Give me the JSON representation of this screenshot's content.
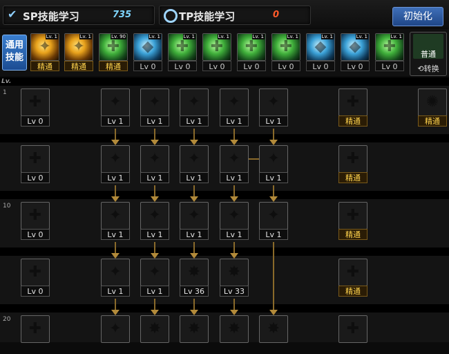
{
  "header": {
    "sp": {
      "label": "SP技能学习",
      "value": "735"
    },
    "tp": {
      "label": "TP技能学习",
      "value": "0"
    },
    "reset_label": "初始化"
  },
  "general": {
    "label_line1": "通用",
    "label_line2": "技能",
    "skills": [
      {
        "name": "general-skill-1",
        "icon": "gold",
        "level": "精通",
        "master": true,
        "tag": "Lv. 1"
      },
      {
        "name": "general-skill-2",
        "icon": "gold",
        "level": "精通",
        "master": true,
        "tag": "Lv. 1"
      },
      {
        "name": "general-skill-3",
        "icon": "green",
        "level": "精通",
        "master": true,
        "tag": "Lv. 90"
      },
      {
        "name": "general-skill-4",
        "icon": "blue",
        "level": "Lv 0",
        "master": false,
        "tag": "Lv. 1"
      },
      {
        "name": "general-skill-5",
        "icon": "green",
        "level": "Lv 0",
        "master": false,
        "tag": "Lv. 1"
      },
      {
        "name": "general-skill-6",
        "icon": "green",
        "level": "Lv 0",
        "master": false,
        "tag": "Lv. 1"
      },
      {
        "name": "general-skill-7",
        "icon": "green",
        "level": "Lv 0",
        "master": false,
        "tag": "Lv. 1"
      },
      {
        "name": "general-skill-8",
        "icon": "green",
        "level": "Lv 0",
        "master": false,
        "tag": "Lv. 1"
      },
      {
        "name": "general-skill-9",
        "icon": "blue",
        "level": "Lv 0",
        "master": false,
        "tag": "Lv. 1"
      },
      {
        "name": "general-skill-10",
        "icon": "blue",
        "level": "Lv 0",
        "master": false,
        "tag": "Lv. 1"
      },
      {
        "name": "general-skill-11",
        "icon": "green",
        "level": "Lv 0",
        "master": false,
        "tag": "Lv. 1"
      }
    ],
    "switch": {
      "top": "普通",
      "bottom": "⟲转换"
    }
  },
  "tree": {
    "lv_header": "Lv.",
    "row_levels": [
      "1",
      "10",
      "20"
    ],
    "skills": [
      {
        "name": "skill-r1-c1",
        "icon": "green",
        "level": "Lv 0",
        "master": false
      },
      {
        "name": "skill-r1-c2",
        "icon": "gold",
        "level": "Lv 1",
        "master": false
      },
      {
        "name": "skill-r1-c3",
        "icon": "gold",
        "level": "Lv 1",
        "master": false
      },
      {
        "name": "skill-r1-c4",
        "icon": "gold",
        "level": "Lv 1",
        "master": false
      },
      {
        "name": "skill-r1-c5",
        "icon": "gold",
        "level": "Lv 1",
        "master": false
      },
      {
        "name": "skill-r1-c6",
        "icon": "gold",
        "level": "Lv 1",
        "master": false
      },
      {
        "name": "skill-r1-c7",
        "icon": "green",
        "level": "精通",
        "master": true
      },
      {
        "name": "skill-r1-c8",
        "icon": "fire",
        "level": "精通",
        "master": true
      },
      {
        "name": "skill-r2-c1",
        "icon": "green",
        "level": "Lv 0",
        "master": false
      },
      {
        "name": "skill-r2-c2",
        "icon": "gold",
        "level": "Lv 1",
        "master": false
      },
      {
        "name": "skill-r2-c3",
        "icon": "gold",
        "level": "Lv 1",
        "master": false
      },
      {
        "name": "skill-r2-c4",
        "icon": "gold",
        "level": "Lv 1",
        "master": false
      },
      {
        "name": "skill-r2-c5",
        "icon": "gold",
        "level": "Lv 1",
        "master": false
      },
      {
        "name": "skill-r2-c6",
        "icon": "gold",
        "level": "Lv 1",
        "master": false
      },
      {
        "name": "skill-r2-c7",
        "icon": "green",
        "level": "精通",
        "master": true
      },
      {
        "name": "skill-r3-c1",
        "icon": "green",
        "level": "Lv 0",
        "master": false
      },
      {
        "name": "skill-r3-c2",
        "icon": "gold",
        "level": "Lv 1",
        "master": false
      },
      {
        "name": "skill-r3-c3",
        "icon": "gold",
        "level": "Lv 1",
        "master": false
      },
      {
        "name": "skill-r3-c4",
        "icon": "gold",
        "level": "Lv 1",
        "master": false
      },
      {
        "name": "skill-r3-c5",
        "icon": "gold",
        "level": "Lv 1",
        "master": false
      },
      {
        "name": "skill-r3-c6",
        "icon": "gold",
        "level": "Lv 1",
        "master": false
      },
      {
        "name": "skill-r3-c7",
        "icon": "green",
        "level": "精通",
        "master": true
      },
      {
        "name": "skill-r4-c1",
        "icon": "green",
        "level": "Lv 0",
        "master": false
      },
      {
        "name": "skill-r4-c2",
        "icon": "gold",
        "level": "Lv 1",
        "master": false
      },
      {
        "name": "skill-r4-c3",
        "icon": "gold",
        "level": "Lv 1",
        "master": false
      },
      {
        "name": "skill-r4-c4",
        "icon": "red",
        "level": "Lv 36",
        "master": false
      },
      {
        "name": "skill-r4-c5",
        "icon": "red",
        "level": "Lv 33",
        "master": false
      },
      {
        "name": "skill-r4-c7",
        "icon": "green",
        "level": "精通",
        "master": true
      },
      {
        "name": "skill-r5-c1",
        "icon": "green",
        "level": "",
        "master": false
      },
      {
        "name": "skill-r5-c2",
        "icon": "gold",
        "level": "",
        "master": false
      },
      {
        "name": "skill-r5-c3",
        "icon": "red",
        "level": "",
        "master": false
      },
      {
        "name": "skill-r5-c4",
        "icon": "red",
        "level": "",
        "master": false
      },
      {
        "name": "skill-r5-c5",
        "icon": "red",
        "level": "",
        "master": false
      },
      {
        "name": "skill-r5-c6",
        "icon": "red",
        "level": "",
        "master": false
      },
      {
        "name": "skill-r5-c7",
        "icon": "green",
        "level": "",
        "master": false
      }
    ]
  }
}
